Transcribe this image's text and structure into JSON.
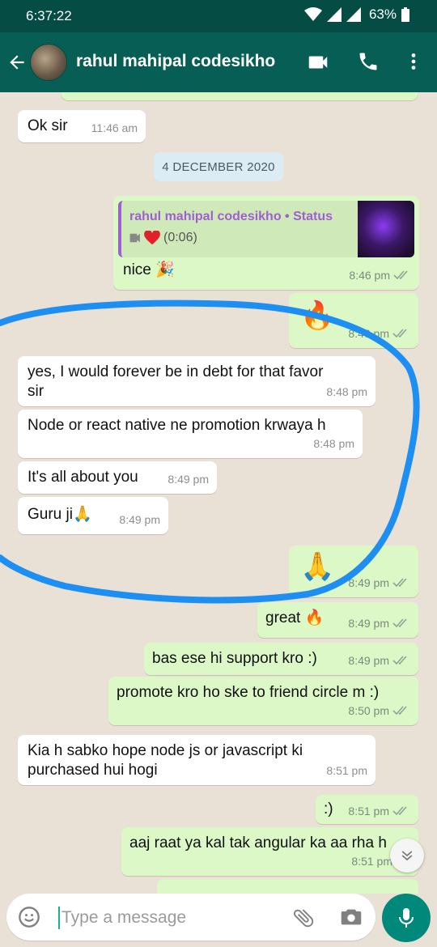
{
  "status_bar": {
    "time": "6:37:22",
    "battery": "63%"
  },
  "header": {
    "contact_name": "rahul mahipal codesikho"
  },
  "colors": {
    "header": "#075e54",
    "status": "#054d44",
    "outgoing": "#dcf8c6",
    "incoming": "#ffffff",
    "accent": "#00897b",
    "read_ticks": "#4fb7f0",
    "highlight_stroke": "#1d8ff2"
  },
  "chat": {
    "date_chip": "4 DECEMBER 2020",
    "messages": [
      {
        "dir": "in",
        "text": "Ok sir",
        "time": "11:46 am"
      },
      {
        "dir": "out",
        "quote_name": "rahul mahipal codesikho • Status",
        "quote_duration": "(0:06)",
        "text": "nice 🎉",
        "time": "8:46 pm"
      },
      {
        "dir": "out",
        "text": "🔥",
        "time": "8:46 pm"
      },
      {
        "dir": "in",
        "line1": "yes, I would forever be in debt for that favor",
        "line2": "sir",
        "time": "8:48 pm"
      },
      {
        "dir": "in",
        "text": "Node or react native ne promotion krwaya h",
        "time": "8:48 pm"
      },
      {
        "dir": "in",
        "text": "It's all about you",
        "time": "8:49 pm"
      },
      {
        "dir": "in",
        "text": "Guru ji🙏",
        "time": "8:49 pm"
      },
      {
        "dir": "out",
        "text": "🙏",
        "time": "8:49 pm"
      },
      {
        "dir": "out",
        "text": "great 🔥",
        "time": "8:49 pm"
      },
      {
        "dir": "out",
        "text": "bas ese hi support kro :)",
        "time": "8:49 pm"
      },
      {
        "dir": "out",
        "text": "promote kro ho ske to friend circle m :)",
        "time": "8:50 pm"
      },
      {
        "dir": "in",
        "line1": "Kia h sabko hope node js or javascript ki",
        "line2": "purchased hui hogi",
        "time": "8:51 pm"
      },
      {
        "dir": "out",
        "text": ":)",
        "time": "8:51 pm"
      },
      {
        "dir": "out",
        "text": "aaj raat ya kal tak angular ka aa rha h",
        "time": "8:51 pm"
      }
    ]
  },
  "input": {
    "placeholder": "Type a message"
  },
  "icons": [
    "back-arrow-icon",
    "video-call-icon",
    "voice-call-icon",
    "more-vert-icon",
    "emoji-icon",
    "attach-icon",
    "camera-icon",
    "mic-icon",
    "scroll-down-icon"
  ]
}
